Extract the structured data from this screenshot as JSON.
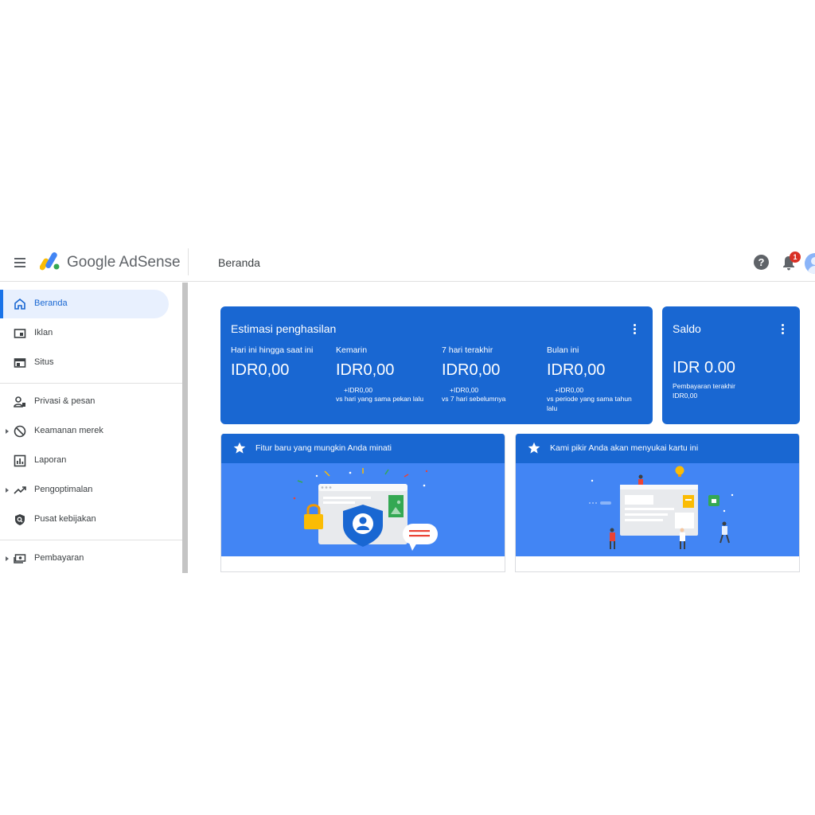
{
  "header": {
    "brand_google": "Google",
    "brand_product": "AdSense",
    "page_title": "Beranda",
    "help_icon_text": "?",
    "notification_count": "1"
  },
  "sidebar": {
    "items": [
      {
        "label": "Beranda",
        "icon": "home-icon",
        "active": true
      },
      {
        "label": "Iklan",
        "icon": "ads-icon"
      },
      {
        "label": "Situs",
        "icon": "sites-icon"
      },
      {
        "label": "Privasi & pesan",
        "icon": "privacy-icon"
      },
      {
        "label": "Keamanan merek",
        "icon": "block-icon",
        "expandable": true
      },
      {
        "label": "Laporan",
        "icon": "report-icon"
      },
      {
        "label": "Pengoptimalan",
        "icon": "trending-icon",
        "expandable": true
      },
      {
        "label": "Pusat kebijakan",
        "icon": "policy-icon"
      },
      {
        "label": "Pembayaran",
        "icon": "payment-icon",
        "expandable": true
      }
    ]
  },
  "earnings": {
    "title": "Estimasi penghasilan",
    "stats": [
      {
        "label": "Hari ini hingga saat ini",
        "value": "IDR0,00",
        "delta": "",
        "compare": ""
      },
      {
        "label": "Kemarin",
        "value": "IDR0,00",
        "delta": "+IDR0,00",
        "compare": "vs hari yang sama pekan lalu"
      },
      {
        "label": "7 hari terakhir",
        "value": "IDR0,00",
        "delta": "+IDR0,00",
        "compare": "vs 7 hari sebelumnya"
      },
      {
        "label": "Bulan ini",
        "value": "IDR0,00",
        "delta": "+IDR0,00",
        "compare": "vs periode yang sama tahun lalu"
      }
    ]
  },
  "balance": {
    "title": "Saldo",
    "value": "IDR 0.00",
    "last_payment_label": "Pembayaran terakhir",
    "last_payment_value": "IDR0,00"
  },
  "promos": [
    {
      "title": "Fitur baru yang mungkin Anda minati",
      "icon": "star-icon"
    },
    {
      "title": "Kami pikir Anda akan menyukai kartu ini",
      "icon": "star-icon"
    }
  ],
  "colors": {
    "primary": "#1967d2",
    "illustration_bg": "#4285f4",
    "active_nav_bg": "#e8f0fe",
    "badge": "#d93025"
  }
}
